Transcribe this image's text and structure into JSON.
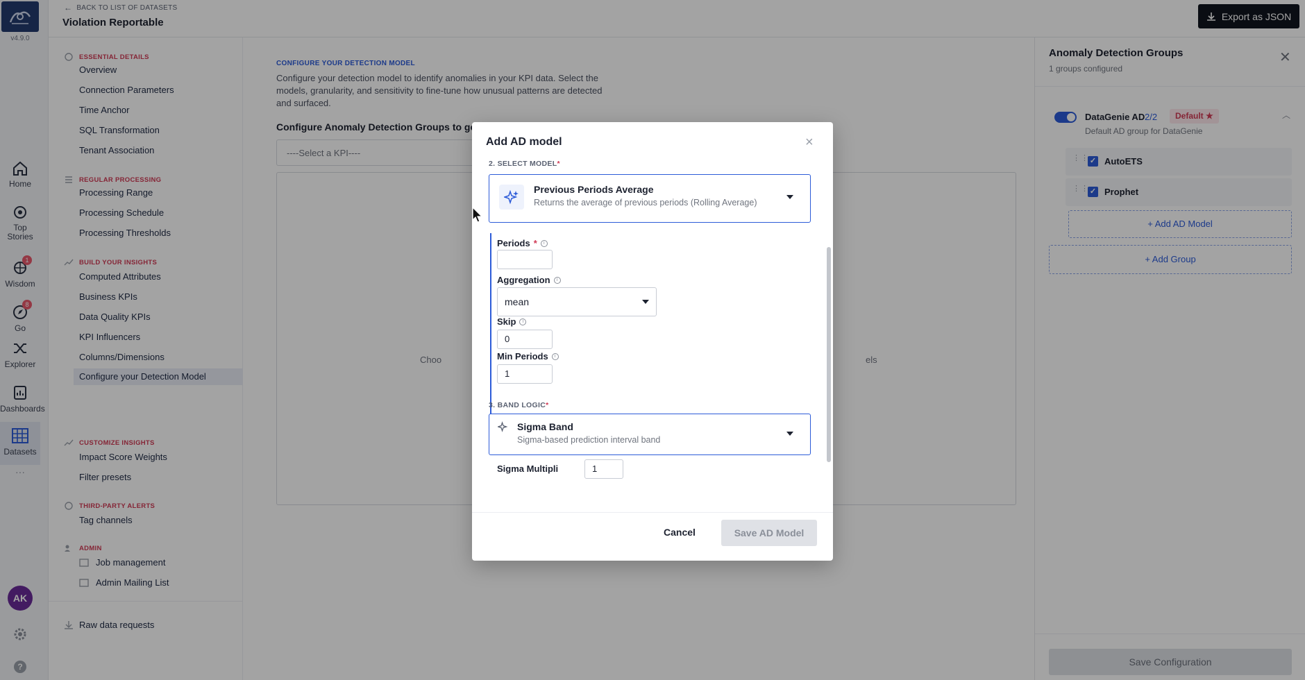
{
  "rail": {
    "version": "v4.9.0",
    "items": [
      {
        "label": "Home",
        "icon": "home-icon"
      },
      {
        "label": "Top\nStories",
        "icon": "eye-icon"
      },
      {
        "label": "Wisdom",
        "icon": "wisdom-icon",
        "badge": "1"
      },
      {
        "label": "Go",
        "icon": "compass-icon",
        "badge": "8"
      },
      {
        "label": "Explorer",
        "icon": "shuffle-icon"
      },
      {
        "label": "Dashboards",
        "icon": "dashboard-icon"
      },
      {
        "label": "Datasets",
        "icon": "grid-icon"
      }
    ],
    "avatar": "AK",
    "more": "···"
  },
  "topbar": {
    "back_label": "BACK TO LIST OF DATASETS",
    "dataset_title": "Violation Reportable",
    "export_label": "Export as JSON"
  },
  "nav": {
    "sections": [
      {
        "title": "ESSENTIAL DETAILS",
        "items": [
          "Overview",
          "Connection Parameters",
          "Time Anchor",
          "SQL Transformation",
          "Tenant Association"
        ]
      },
      {
        "title": "REGULAR PROCESSING",
        "items": [
          "Processing Range",
          "Processing Schedule",
          "Processing Thresholds"
        ]
      },
      {
        "title": "BUILD YOUR INSIGHTS",
        "items": [
          "Computed Attributes",
          "Business KPIs",
          "Data Quality KPIs",
          "KPI Influencers",
          "Columns/Dimensions",
          "Configure your Detection Model"
        ]
      },
      {
        "title": "CUSTOMIZE INSIGHTS",
        "items": [
          "Impact Score Weights",
          "Filter presets"
        ]
      },
      {
        "title": "THIRD-PARTY ALERTS",
        "items": [
          "Tag channels"
        ]
      },
      {
        "title": "ADMIN",
        "items": [
          "Job management",
          "Admin Mailing List"
        ]
      }
    ],
    "raw_requests": "Raw data requests"
  },
  "main": {
    "heading": "CONFIGURE YOUR DETECTION MODEL",
    "description": "Configure your detection model to identify anomalies in your KPI data. Select the models, granularity, and sensitivity to fine-tune how unusual patterns are detected and surfaced.",
    "subheading": "Configure Anomaly Detection Groups to gene",
    "kpi_placeholder": "----Select a KPI----",
    "empty_left": "Choo",
    "empty_right": "els"
  },
  "right_panel": {
    "title": "Anomaly Detection Groups",
    "subtitle": "1 groups configured",
    "group": {
      "name": "DataGenie AD",
      "count": "2/2",
      "badge": "Default",
      "description": "Default AD group for DataGenie",
      "models": [
        "AutoETS",
        "Prophet"
      ]
    },
    "add_model": "+ Add AD Model",
    "add_group": "+ Add Group",
    "save": "Save Configuration"
  },
  "modal": {
    "title": "Add AD model",
    "step_model": "2. SELECT MODEL",
    "model_name": "Previous Periods Average",
    "model_desc": "Returns the average of previous periods (Rolling Average)",
    "params": {
      "periods_label": "Periods",
      "periods_value": "",
      "aggregation_label": "Aggregation",
      "aggregation_value": "mean",
      "skip_label": "Skip",
      "skip_value": "0",
      "min_periods_label": "Min Periods",
      "min_periods_value": "1"
    },
    "step_band": "3. BAND LOGIC",
    "band_name": "Sigma Band",
    "band_desc": "Sigma-based prediction interval band",
    "band_param_partial": "Sigma Multipli",
    "band_param_value": "1",
    "cancel": "Cancel",
    "save": "Save AD Model"
  },
  "colors": {
    "accent": "#2c5bd8",
    "brand_dark": "#233a6e",
    "danger": "#d03a55"
  }
}
